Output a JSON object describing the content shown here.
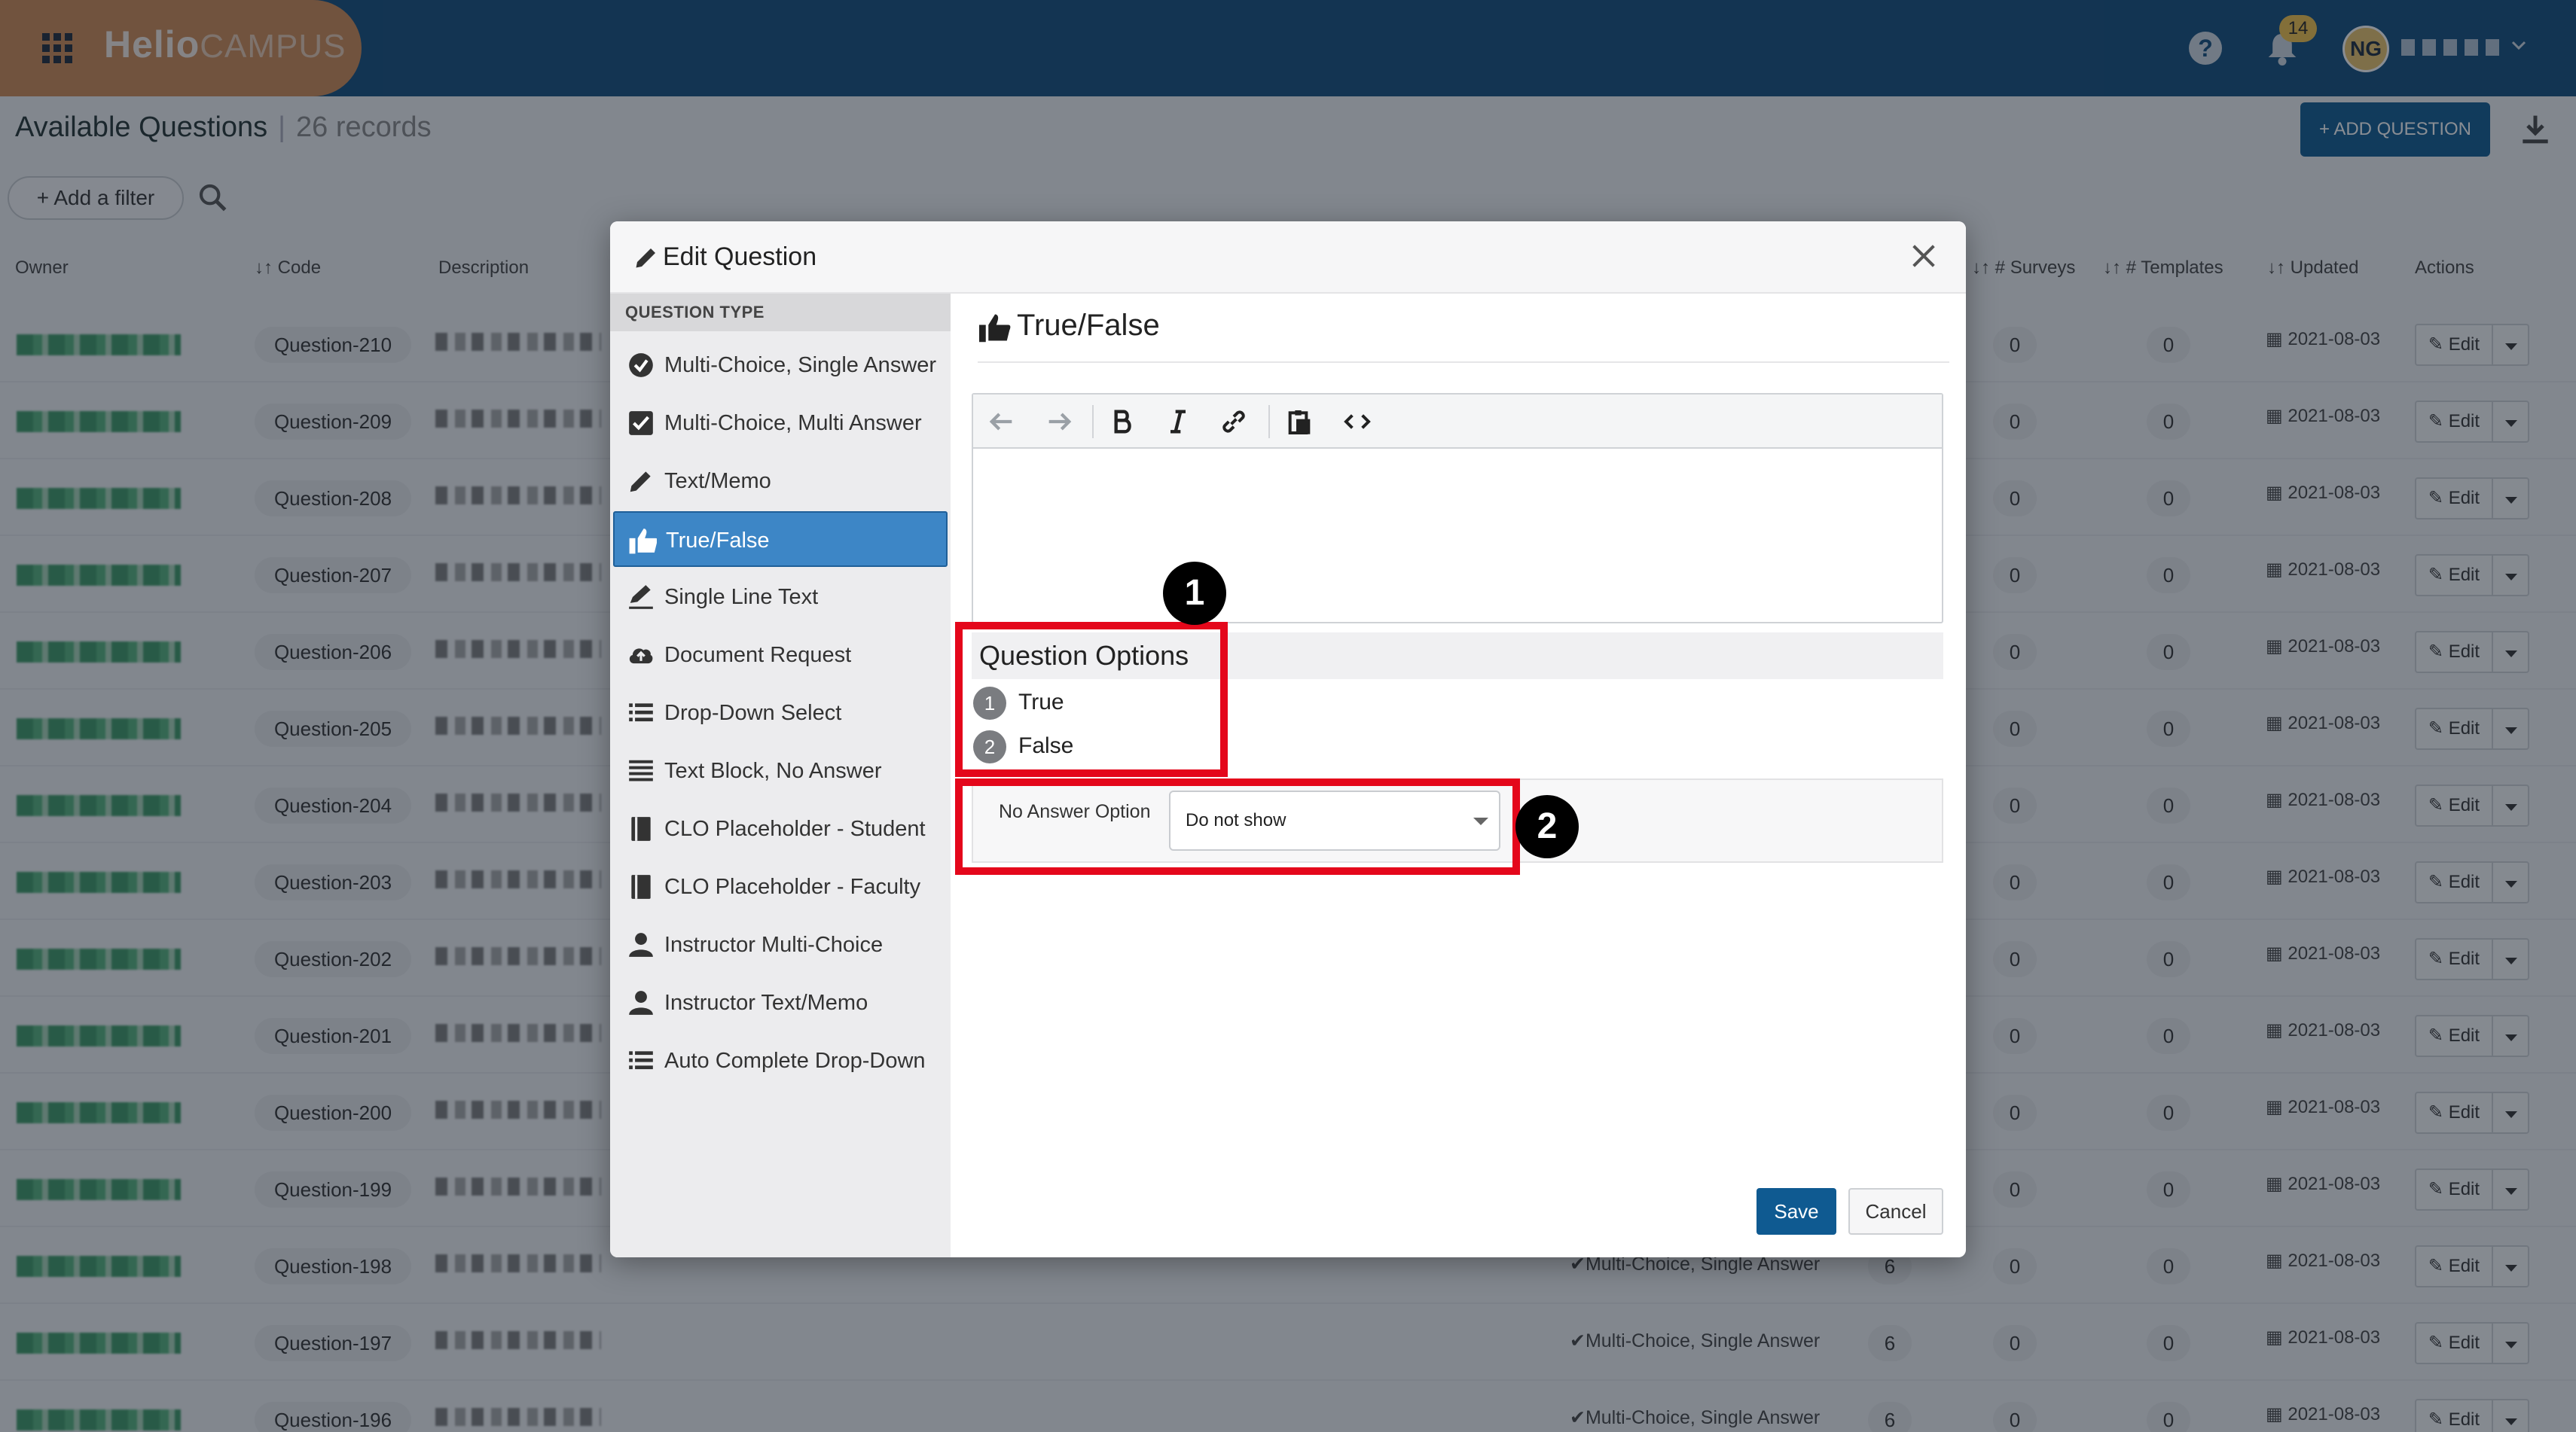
{
  "app": {
    "brand_bold": "Helio",
    "brand_light": "CAMPUS",
    "notification_count": "14",
    "user_initials": "NG"
  },
  "page": {
    "title": "Available Questions",
    "separator": "|",
    "record_count": "26 records",
    "add_question_label": "+ ADD QUESTION",
    "add_filter_label": "+ Add a filter"
  },
  "table": {
    "headers": {
      "owner": "Owner",
      "code": "Code",
      "description": "Description",
      "surveys": "# Surveys",
      "templates": "# Templates",
      "updated": "Updated",
      "actions": "Actions"
    },
    "rows": [
      {
        "code": "Question-210",
        "type": "",
        "num1": "",
        "surveys": "0",
        "templates": "0",
        "updated": "2021-08-03",
        "action": "Edit"
      },
      {
        "code": "Question-209",
        "type": "",
        "num1": "",
        "surveys": "0",
        "templates": "0",
        "updated": "2021-08-03",
        "action": "Edit"
      },
      {
        "code": "Question-208",
        "type": "",
        "num1": "",
        "surveys": "0",
        "templates": "0",
        "updated": "2021-08-03",
        "action": "Edit"
      },
      {
        "code": "Question-207",
        "type": "",
        "num1": "",
        "surveys": "0",
        "templates": "0",
        "updated": "2021-08-03",
        "action": "Edit"
      },
      {
        "code": "Question-206",
        "type": "",
        "num1": "",
        "surveys": "0",
        "templates": "0",
        "updated": "2021-08-03",
        "action": "Edit"
      },
      {
        "code": "Question-205",
        "type": "",
        "num1": "",
        "surveys": "0",
        "templates": "0",
        "updated": "2021-08-03",
        "action": "Edit"
      },
      {
        "code": "Question-204",
        "type": "",
        "num1": "",
        "surveys": "0",
        "templates": "0",
        "updated": "2021-08-03",
        "action": "Edit"
      },
      {
        "code": "Question-203",
        "type": "",
        "num1": "",
        "surveys": "0",
        "templates": "0",
        "updated": "2021-08-03",
        "action": "Edit"
      },
      {
        "code": "Question-202",
        "type": "",
        "num1": "",
        "surveys": "0",
        "templates": "0",
        "updated": "2021-08-03",
        "action": "Edit"
      },
      {
        "code": "Question-201",
        "type": "",
        "num1": "",
        "surveys": "0",
        "templates": "0",
        "updated": "2021-08-03",
        "action": "Edit"
      },
      {
        "code": "Question-200",
        "type": "",
        "num1": "",
        "surveys": "0",
        "templates": "0",
        "updated": "2021-08-03",
        "action": "Edit"
      },
      {
        "code": "Question-199",
        "type": "",
        "num1": "",
        "surveys": "0",
        "templates": "0",
        "updated": "2021-08-03",
        "action": "Edit"
      },
      {
        "code": "Question-198",
        "type": "Multi-Choice, Single Answer",
        "num1": "6",
        "surveys": "0",
        "templates": "0",
        "updated": "2021-08-03",
        "action": "Edit"
      },
      {
        "code": "Question-197",
        "type": "Multi-Choice, Single Answer",
        "num1": "6",
        "surveys": "0",
        "templates": "0",
        "updated": "2021-08-03",
        "action": "Edit"
      },
      {
        "code": "Question-196",
        "type": "Multi-Choice, Single Answer",
        "num1": "6",
        "surveys": "0",
        "templates": "0",
        "updated": "2021-08-03",
        "action": "Edit"
      }
    ]
  },
  "modal": {
    "title": "Edit Question",
    "question_type_header": "QUESTION TYPE",
    "question_types": [
      {
        "label": "Multi-Choice, Single Answer",
        "icon": "check-circle-icon"
      },
      {
        "label": "Multi-Choice, Multi Answer",
        "icon": "checkbox-icon"
      },
      {
        "label": "Text/Memo",
        "icon": "pencil-icon"
      },
      {
        "label": "True/False",
        "icon": "thumbs-up-icon"
      },
      {
        "label": "Single Line Text",
        "icon": "signature-icon"
      },
      {
        "label": "Document Request",
        "icon": "cloud-upload-icon"
      },
      {
        "label": "Drop-Down Select",
        "icon": "list-icon"
      },
      {
        "label": "Text Block, No Answer",
        "icon": "align-justify-icon"
      },
      {
        "label": "CLO Placeholder - Student",
        "icon": "book-icon"
      },
      {
        "label": "CLO Placeholder - Faculty",
        "icon": "book-icon"
      },
      {
        "label": "Instructor Multi-Choice",
        "icon": "user-icon"
      },
      {
        "label": "Instructor Text/Memo",
        "icon": "user-icon"
      },
      {
        "label": "Auto Complete Drop-Down",
        "icon": "list-icon"
      }
    ],
    "selected_type": "True/False",
    "main_title": "True/False",
    "options_title": "Question Options",
    "options": [
      {
        "num": "1",
        "label": "True"
      },
      {
        "num": "2",
        "label": "False"
      }
    ],
    "no_answer_label": "No Answer Option",
    "no_answer_value": "Do not show",
    "save_label": "Save",
    "cancel_label": "Cancel"
  },
  "callouts": [
    "1",
    "2"
  ],
  "colors": {
    "topbar": "#114d7d",
    "brand_accent": "#cf8a54",
    "primary": "#0f5a91",
    "active_item": "#3d86c6",
    "callout_red": "#e4071b"
  }
}
